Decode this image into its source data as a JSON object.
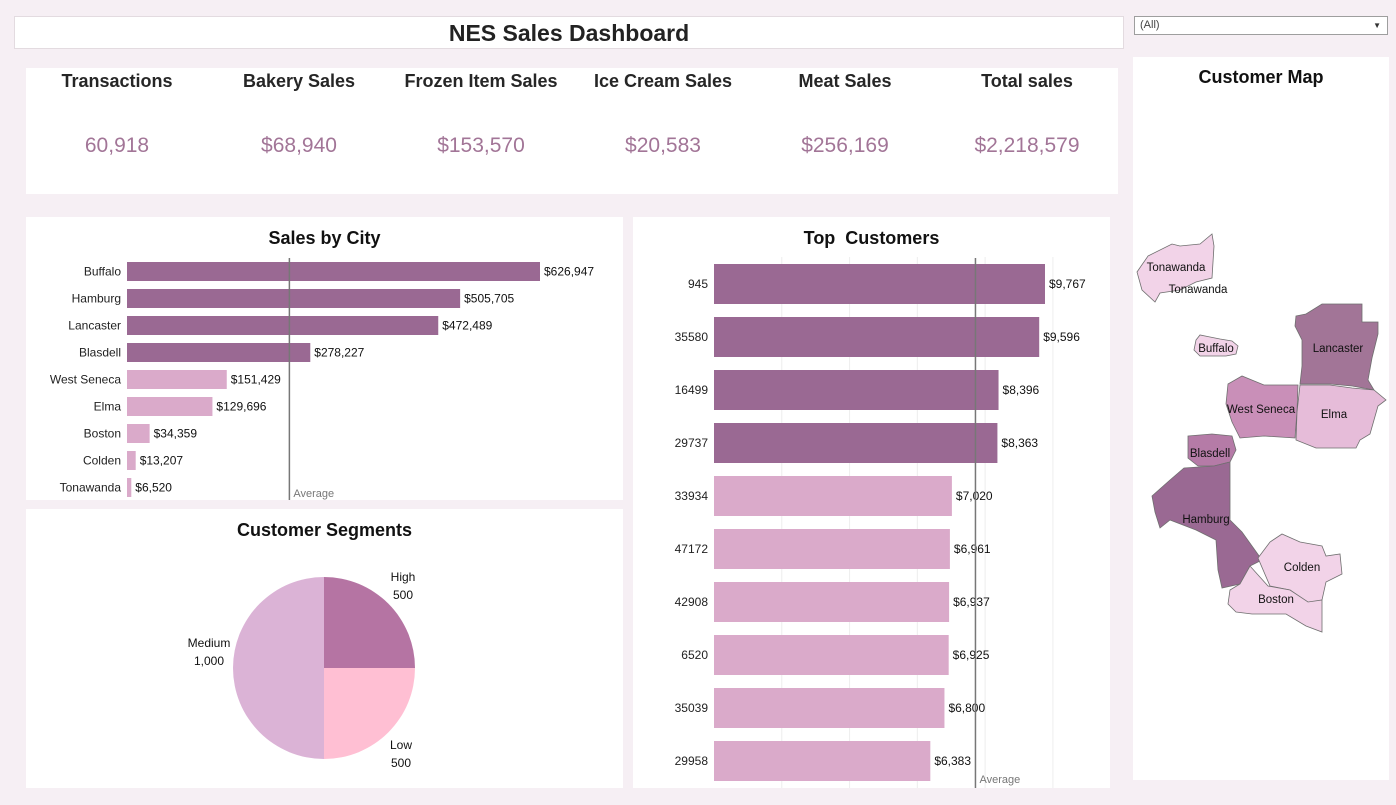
{
  "dashboard": {
    "title": "NES Sales Dashboard"
  },
  "filter": {
    "value": "(All)",
    "arrow": "▼"
  },
  "kpis": [
    {
      "label": "Transactions",
      "value": "60,918"
    },
    {
      "label": "Bakery Sales",
      "value": "$68,940"
    },
    {
      "label": "Frozen Item Sales",
      "value": "$153,570"
    },
    {
      "label": "Ice Cream Sales",
      "value": "$20,583"
    },
    {
      "label": "Meat Sales",
      "value": "$256,169"
    },
    {
      "label": "Total sales",
      "value": "$2,218,579"
    }
  ],
  "colors": {
    "dark_bar": "#9a6993",
    "light_bar": "#daaaca",
    "pie_high": "#b574a3",
    "pie_low": "#ffbfd3",
    "pie_medium": "#dbb3d6",
    "kpi_value": "#a27597"
  },
  "chart_data": [
    {
      "type": "bar",
      "orientation": "horizontal",
      "title": "Sales by City",
      "categories": [
        "Buffalo",
        "Hamburg",
        "Lancaster",
        "Blasdell",
        "West Seneca",
        "Elma",
        "Boston",
        "Colden",
        "Tonawanda"
      ],
      "values": [
        626947,
        505705,
        472489,
        278227,
        151429,
        129696,
        34359,
        13207,
        6520
      ],
      "data_labels": [
        "$626,947",
        "$505,705",
        "$472,489",
        "$278,227",
        "$151,429",
        "$129,696",
        "$34,359",
        "$13,207",
        "$6,520"
      ],
      "above_average": [
        true,
        true,
        true,
        true,
        false,
        false,
        false,
        false,
        false
      ],
      "reference_line": {
        "label": "Average",
        "value": 246509
      },
      "xlim": [
        0,
        650000
      ]
    },
    {
      "type": "pie",
      "title": "Customer Segments",
      "slices": [
        {
          "label": "High",
          "value": 500,
          "display": "500"
        },
        {
          "label": "Low",
          "value": 500,
          "display": "500"
        },
        {
          "label": "Medium",
          "value": 1000,
          "display": "1,000"
        }
      ]
    },
    {
      "type": "bar",
      "orientation": "horizontal",
      "title": "Top  Customers",
      "categories": [
        "945",
        "35580",
        "16499",
        "29737",
        "33934",
        "47172",
        "42908",
        "6520",
        "35039",
        "29958"
      ],
      "values": [
        9767,
        9596,
        8396,
        8363,
        7020,
        6961,
        6937,
        6925,
        6800,
        6383
      ],
      "data_labels": [
        "$9,767",
        "$9,596",
        "$8,396",
        "$8,363",
        "$7,020",
        "$6,961",
        "$6,937",
        "$6,925",
        "$6,800",
        "$6,383"
      ],
      "above_average": [
        true,
        true,
        true,
        true,
        false,
        false,
        false,
        false,
        false,
        false
      ],
      "reference_line": {
        "label": "Average",
        "value": 7715
      },
      "xlim": [
        0,
        10000
      ],
      "grid": true
    }
  ],
  "map": {
    "title": "Customer Map",
    "regions": [
      {
        "name": "Tonawanda",
        "labels": [
          "Tonawanda",
          "Tonawanda"
        ],
        "fill": "#f2d3e8"
      },
      {
        "name": "Buffalo",
        "labels": [
          "Buffalo"
        ],
        "fill": "#f2d3e8"
      },
      {
        "name": "Lancaster",
        "labels": [
          "Lancaster"
        ],
        "fill": "#a27597"
      },
      {
        "name": "West Seneca",
        "labels": [
          "West Seneca"
        ],
        "fill": "#c98fb8"
      },
      {
        "name": "Elma",
        "labels": [
          "Elma"
        ],
        "fill": "#e6bcd9"
      },
      {
        "name": "Blasdell",
        "labels": [
          "Blasdell"
        ],
        "fill": "#b57ba7"
      },
      {
        "name": "Hamburg",
        "labels": [
          "Hamburg"
        ],
        "fill": "#9a6993"
      },
      {
        "name": "Colden",
        "labels": [
          "Colden"
        ],
        "fill": "#f2d3e8"
      },
      {
        "name": "Boston",
        "labels": [
          "Boston"
        ],
        "fill": "#f2d3e8"
      }
    ]
  }
}
